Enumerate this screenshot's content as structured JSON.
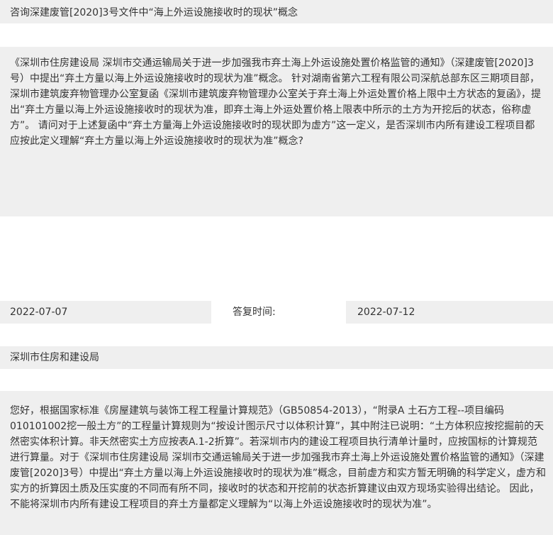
{
  "consultation": {
    "title": "咨询深建废管[2020]3号文件中“海上外运设施接收时的现状”概念",
    "question": "《深圳市住房建设局 深圳市交通运输局关于进一步加强我市弃土海上外运设施处置价格监管的通知》（深建废管[2020]3号）中提出“弃土方量以海上外运设施接收时的现状为准”概念。 针对湖南省第六工程有限公司深航总部东区三期项目部，深圳市建筑废弃物管理办公室复函《深圳市建筑废弃物管理办公室关于弃土海上外运处置价格上限中土方状态的复函》，提出“弃土方量以海上外运设施接收时的现状为准，即弃土海上外运处置价格上限表中所示的土方为开挖后的状态，俗称虚方”。 请问对于上述复函中“弃土方量海上外运设施接收时的现状即为虚方”这一定义，是否深圳市内所有建设工程项目都应按此定义理解“弃土方量以海上外运设施接收时的现状为准”概念?",
    "ask_date": "2022-07-07",
    "reply_label": "答复时间:",
    "reply_date": "2022-07-12",
    "department": "深圳市住房和建设局",
    "answer": "您好，根据国家标准《房屋建筑与装饰工程工程量计算规范》（GB50854-2013），“附录A 土石方工程--项目编码010101002挖一般土方”的工程量计算规则为“按设计图示尺寸以体积计算”，其中附注已说明：“土方体积应按挖掘前的天然密实体积计算。非天然密实土方应按表A.1-2折算”。若深圳市内的建设工程项目执行清单计量时，应按国标的计算规范进行算量。对于《深圳市住房建设局 深圳市交通运输局关于进一步加强我市弃土海上外运设施处置价格监管的通知》（深建废管[2020]3号）中提出“弃土方量以海上外运设施接收时的现状为准”概念，目前虚方和实方暂无明确的科学定义，虚方和实方的折算因土质及压实度的不同而有所不同，接收时的状态和开挖前的状态折算建议由双方现场实验得出结论。 因此，不能将深圳市内所有建设工程项目的弃土方量都定义理解为“以海上外运设施接收时的现状为准”。"
  }
}
